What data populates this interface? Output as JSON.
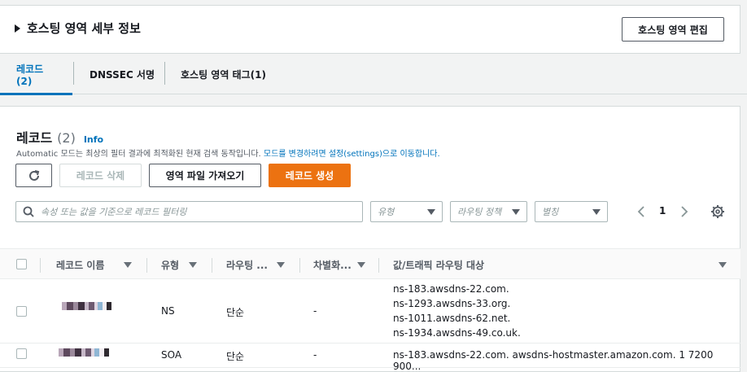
{
  "hosted_zone": {
    "details_title": "호스팅 영역 세부 정보",
    "edit_button": "호스팅 영역 편집"
  },
  "tabs": [
    {
      "label": "레코드(2)",
      "active": true
    },
    {
      "label": "DNSSEC 서명",
      "active": false
    },
    {
      "label": "호스팅 영역 태그(1)",
      "active": false
    }
  ],
  "records_panel": {
    "title": "레코드",
    "count": "(2)",
    "info": "Info",
    "description": "Automatic 모드는 최상의 필터 결과에 최적화된 현재 검색 동작입니다.",
    "description_link": "모드를 변경하려면 설정(settings)으로 이동합니다.",
    "buttons": {
      "refresh_icon": "refresh-icon",
      "delete": "레코드 삭제",
      "import": "영역 파일 가져오기",
      "create": "레코드 생성"
    },
    "filter_placeholder": "속성 또는 값을 기준으로 레코드 필터링",
    "selects": {
      "type": "유형",
      "routing": "라우팅 정책",
      "alias": "별칭"
    },
    "page": "1"
  },
  "table": {
    "headers": [
      "레코드 이름",
      "유형",
      "라우팅 ...",
      "차별화...",
      "값/트래픽 라우팅 대상"
    ],
    "rows": [
      {
        "type": "NS",
        "routing": "단순",
        "diff": "-",
        "values": [
          "ns-183.awsdns-22.com.",
          "ns-1293.awsdns-33.org.",
          "ns-1011.awsdns-62.net.",
          "ns-1934.awsdns-49.co.uk."
        ]
      },
      {
        "type": "SOA",
        "routing": "단순",
        "diff": "-",
        "values": [
          "ns-183.awsdns-22.com. awsdns-hostmaster.amazon.com. 1 7200 900..."
        ]
      }
    ]
  },
  "colors": {
    "accent": "#0073bb",
    "primary_button": "#ec7211"
  }
}
